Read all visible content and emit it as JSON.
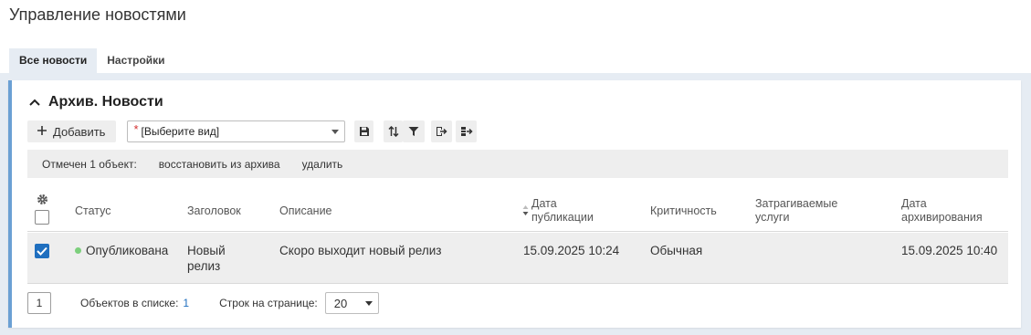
{
  "page": {
    "title": "Управление новостями"
  },
  "tabs": [
    {
      "label": "Все новости",
      "active": true
    },
    {
      "label": "Настройки",
      "active": false
    }
  ],
  "panel": {
    "title": "Архив. Новости",
    "accent_color": "#6ba0d4"
  },
  "toolbar": {
    "add_label": "Добавить",
    "view_select": {
      "required_mark": "*",
      "value": "[Выберите вид]"
    },
    "icons": [
      "save-icon",
      "sort-icon",
      "filter-icon",
      "export-icon",
      "columns-export-icon"
    ]
  },
  "selection_bar": {
    "text": "Отмечен 1 объект:",
    "restore_label": "восстановить из архива",
    "delete_label": "удалить"
  },
  "table": {
    "headers": {
      "status": "Статус",
      "title": "Заголовок",
      "description": "Описание",
      "pub_date_1": "Дата",
      "pub_date_2": "публикации",
      "criticality": "Критичность",
      "services_1": "Затрагиваемые",
      "services_2": "услуги",
      "archive_date_1": "Дата",
      "archive_date_2": "архивирования"
    },
    "rows": [
      {
        "checked": true,
        "status": "Опубликована",
        "status_color": "#7ccf7c",
        "title_1": "Новый",
        "title_2": "релиз",
        "description": "Скоро выходит новый релиз",
        "pub_date": "15.09.2025 10:24",
        "criticality": "Обычная",
        "services": "",
        "archive_date": "15.09.2025 10:40"
      }
    ]
  },
  "footer": {
    "page": "1",
    "count_label": "Объектов в списке:",
    "count_value": "1",
    "rows_label": "Строк на странице:",
    "rows_value": "20"
  },
  "colors": {
    "accent": "#1f6fbf",
    "band": "#e6ecf3"
  }
}
